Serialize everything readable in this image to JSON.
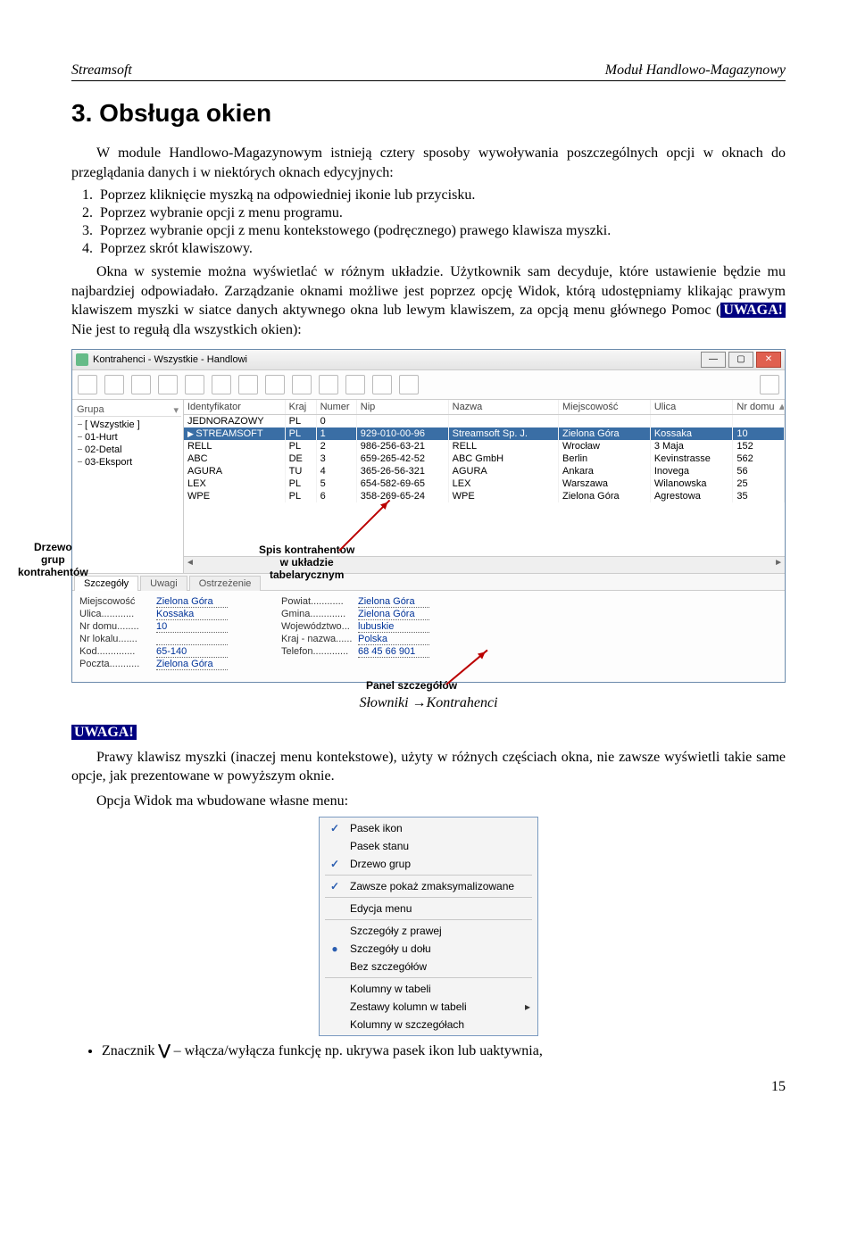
{
  "header": {
    "left": "Streamsoft",
    "right": "Moduł Handlowo-Magazynowy"
  },
  "title": "3. Obsługa okien",
  "intro": "W module Handlowo-Magazynowym istnieją cztery sposoby wywoływania poszczególnych opcji w oknach do przeglądania danych i w niektórych oknach edycyjnych:",
  "list": [
    "Poprzez kliknięcie myszką na odpowiedniej ikonie lub przycisku.",
    "Poprzez wybranie opcji z menu programu.",
    "Poprzez wybranie opcji z menu kontekstowego (podręcznego) prawego klawisza myszki.",
    "Poprzez skrót klawiszowy."
  ],
  "para2a": "Okna w systemie można wyświetlać w różnym układzie. Użytkownik sam decyduje, które ustawienie będzie mu najbardziej odpowiadało. Zarządzanie oknami możliwe jest poprzez opcję Widok, którą udostępniamy klikając prawym klawiszem myszki w siatce danych aktywnego okna lub lewym klawiszem, za opcją menu głównego Pomoc (",
  "uwaga": "UWAGA!",
  "para2b": " Nie jest to regułą dla wszystkich okien):",
  "win": {
    "title": "Kontrahenci - Wszystkie - Handlowi",
    "tree_header": "Grupa",
    "tree": [
      "[ Wszystkie ]",
      "01-Hurt",
      "02-Detal",
      "03-Eksport"
    ],
    "cols": [
      "Identyfikator",
      "Kraj",
      "Numer",
      "Nip",
      "Nazwa",
      "Miejscowość",
      "Ulica",
      "Nr domu"
    ],
    "rows": [
      {
        "id": "JEDNORAZOWY",
        "kraj": "PL",
        "nr": "0",
        "nip": "",
        "nazwa": "",
        "miej": "",
        "ul": "",
        "dom": ""
      },
      {
        "id": "STREAMSOFT",
        "kraj": "PL",
        "nr": "1",
        "nip": "929-010-00-96",
        "nazwa": "Streamsoft Sp. J.",
        "miej": "Zielona Góra",
        "ul": "Kossaka",
        "dom": "10",
        "sel": true
      },
      {
        "id": "RELL",
        "kraj": "PL",
        "nr": "2",
        "nip": "986-256-63-21",
        "nazwa": "RELL",
        "miej": "Wrocław",
        "ul": "3 Maja",
        "dom": "152"
      },
      {
        "id": "ABC",
        "kraj": "DE",
        "nr": "3",
        "nip": "659-265-42-52",
        "nazwa": "ABC GmbH",
        "miej": "Berlin",
        "ul": "Kevinstrasse",
        "dom": "562"
      },
      {
        "id": "AGURA",
        "kraj": "TU",
        "nr": "4",
        "nip": "365-26-56-321",
        "nazwa": "AGURA",
        "miej": "Ankara",
        "ul": "Inovega",
        "dom": "56"
      },
      {
        "id": "LEX",
        "kraj": "PL",
        "nr": "5",
        "nip": "654-582-69-65",
        "nazwa": "LEX",
        "miej": "Warszawa",
        "ul": "Wilanowska",
        "dom": "25"
      },
      {
        "id": "WPE",
        "kraj": "PL",
        "nr": "6",
        "nip": "358-269-65-24",
        "nazwa": "WPE",
        "miej": "Zielona Góra",
        "ul": "Agrestowa",
        "dom": "35"
      }
    ],
    "tabs": [
      "Szczegóły",
      "Uwagi",
      "Ostrzeżenie"
    ],
    "details_left": [
      {
        "l": "Miejscowość",
        "v": "Zielona Góra"
      },
      {
        "l": "Ulica............",
        "v": "Kossaka"
      },
      {
        "l": "Nr domu........",
        "v": "10"
      },
      {
        "l": "Nr lokalu.......",
        "v": ""
      },
      {
        "l": "Kod..............",
        "v": "65-140"
      },
      {
        "l": "Poczta...........",
        "v": "Zielona Góra"
      }
    ],
    "details_right": [
      {
        "l": "Powiat............",
        "v": "Zielona Góra"
      },
      {
        "l": "Gmina.............",
        "v": "Zielona Góra"
      },
      {
        "l": "Województwo...",
        "v": "lubuskie"
      },
      {
        "l": "Kraj - nazwa......",
        "v": "Polska"
      },
      {
        "l": "Telefon.............",
        "v": "68 45 66 901"
      }
    ]
  },
  "callouts": {
    "tree": "Drzewo\ngrup\nkontrahentów",
    "grid": "Spis kontrahentów\nw układzie\ntabelarycznym",
    "panel": "Panel szczegółów"
  },
  "caption": "Słowniki →Kontrahenci",
  "para3": "Prawy klawisz myszki (inaczej menu kontekstowe), użyty w różnych częściach okna, nie zawsze wyświetli takie same opcje, jak prezentowane w powyższym oknie.",
  "para4": "Opcja Widok ma wbudowane własne menu:",
  "menu": [
    {
      "chk": "✓",
      "t": "Pasek ikon"
    },
    {
      "chk": "",
      "t": "Pasek stanu"
    },
    {
      "chk": "✓",
      "t": "Drzewo grup"
    },
    {
      "sep": true
    },
    {
      "chk": "✓",
      "t": "Zawsze pokaż zmaksymalizowane"
    },
    {
      "sep": true
    },
    {
      "chk": "",
      "t": "Edycja menu"
    },
    {
      "sep": true
    },
    {
      "chk": "",
      "t": "Szczegóły z prawej"
    },
    {
      "dot": "●",
      "t": "Szczegóły u dołu"
    },
    {
      "chk": "",
      "t": "Bez szczegółów"
    },
    {
      "sep": true
    },
    {
      "chk": "",
      "t": "Kolumny w tabeli"
    },
    {
      "chk": "",
      "t": "Zestawy kolumn w tabeli",
      "ar": "▸"
    },
    {
      "chk": "",
      "t": "Kolumny w szczegółach"
    }
  ],
  "bullet": "Znacznik ⋁ – włącza/wyłącza funkcję np. ukrywa pasek ikon lub uaktywnia,",
  "pagenum": "15"
}
